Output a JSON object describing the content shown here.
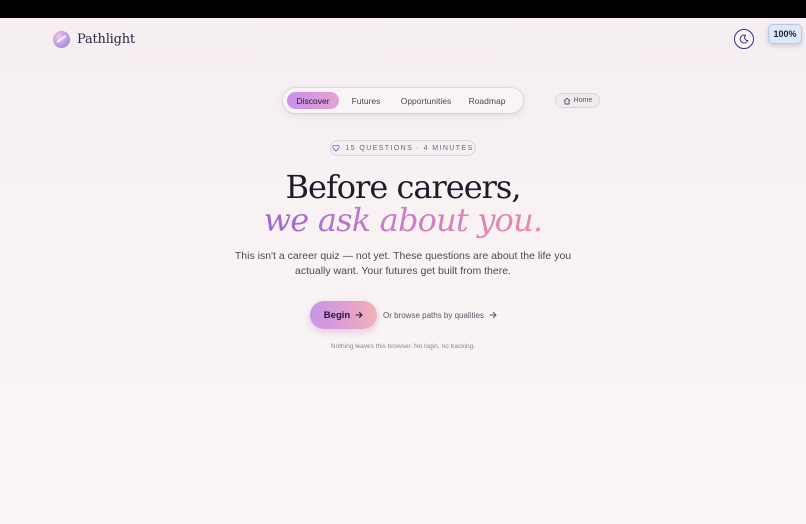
{
  "brand": {
    "name": "Pathlight"
  },
  "browser": {
    "zoom": "100%"
  },
  "nav": {
    "items": [
      {
        "label": "Discover",
        "active": true
      },
      {
        "label": "Futures",
        "active": false
      },
      {
        "label": "Opportunities",
        "active": false
      },
      {
        "label": "Roadmap",
        "active": false
      }
    ],
    "home_label": "Home"
  },
  "hero": {
    "pill": "15 QUESTIONS · 4 MINUTES",
    "title_line1": "Before careers,",
    "title_line2": "we ask about you.",
    "subtitle_line1": "This isn't a career quiz — not yet. These questions are about the life you",
    "subtitle_line2": "actually want. Your futures get built from there.",
    "begin_label": "Begin",
    "browse_label": "Or browse paths by qualities",
    "footnote": "Nothing leaves this browser. No login, no tracking."
  },
  "colors": {
    "accent_start": "#c990e6",
    "accent_end": "#e98aa8",
    "text_dark": "#1d1a2a"
  },
  "icons": [
    "moon-icon",
    "home-icon",
    "heart-icon",
    "arrow-right-icon"
  ]
}
